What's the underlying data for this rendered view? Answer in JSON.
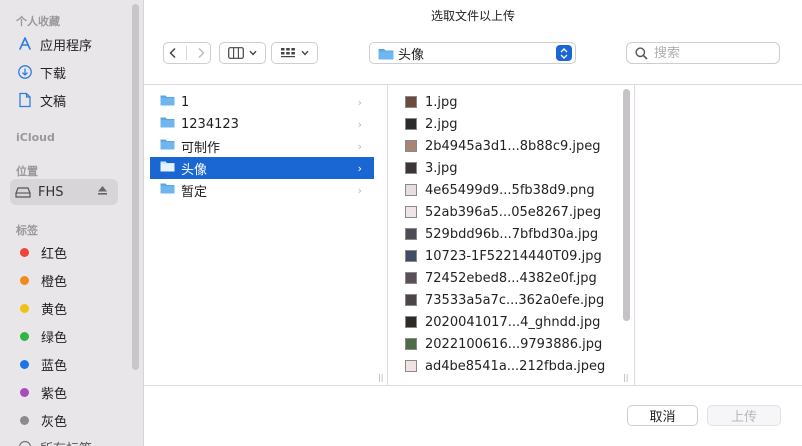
{
  "dialog": {
    "title": "选取文件以上传"
  },
  "sidebar": {
    "favorites": {
      "title": "个人收藏",
      "items": [
        {
          "label": "应用程序",
          "icon": "applications-icon"
        },
        {
          "label": "下载",
          "icon": "download-icon"
        },
        {
          "label": "文稿",
          "icon": "document-icon"
        }
      ]
    },
    "icloud": {
      "title": "iCloud"
    },
    "locations": {
      "title": "位置",
      "items": [
        {
          "label": "FHS",
          "icon": "drive-icon",
          "eject_icon": "eject-icon"
        }
      ]
    },
    "tags": {
      "title": "标签",
      "items": [
        {
          "label": "红色",
          "color": "#f0423a"
        },
        {
          "label": "橙色",
          "color": "#f28a1a"
        },
        {
          "label": "黄色",
          "color": "#f2c10f"
        },
        {
          "label": "绿色",
          "color": "#2fb544"
        },
        {
          "label": "蓝色",
          "color": "#1b74e8"
        },
        {
          "label": "紫色",
          "color": "#a84bbd"
        },
        {
          "label": "灰色",
          "color": "#8c8a8d"
        }
      ],
      "partial_label": "所有标签"
    }
  },
  "toolbar": {
    "back_icon": "chevron-left-icon",
    "forward_icon": "chevron-right-icon",
    "view_icon": "column-view-icon",
    "group_icon": "grid-view-icon",
    "path_label": "头像",
    "search_placeholder": "搜索"
  },
  "browser": {
    "folders": [
      {
        "name": "1"
      },
      {
        "name": "1234123"
      },
      {
        "name": "可制作"
      },
      {
        "name": "头像",
        "selected": true
      },
      {
        "name": "暂定"
      }
    ],
    "files": [
      {
        "name": "1.jpg"
      },
      {
        "name": "2.jpg"
      },
      {
        "name": "2b4945a3d1...8b88c9.jpeg"
      },
      {
        "name": "3.jpg"
      },
      {
        "name": "4e65499d9...5fb38d9.png"
      },
      {
        "name": "52ab396a5...05e8267.jpeg"
      },
      {
        "name": "529bdd96b...7bfbd30a.jpg"
      },
      {
        "name": "10723-1F52214440T09.jpg"
      },
      {
        "name": "72452ebed8...4382e0f.jpg"
      },
      {
        "name": "73533a5a7c...362a0efe.jpg"
      },
      {
        "name": "2020041017...4_ghndd.jpg"
      },
      {
        "name": "2022100616...9793886.jpg"
      },
      {
        "name": "ad4be8541a...212fbda.jpeg"
      }
    ]
  },
  "footer": {
    "cancel_label": "取消",
    "upload_label": "上传"
  },
  "colors": {
    "accent": "#1a66d2",
    "folder": "#5aa7e6",
    "sidebar_bg": "#e8e6e9"
  }
}
